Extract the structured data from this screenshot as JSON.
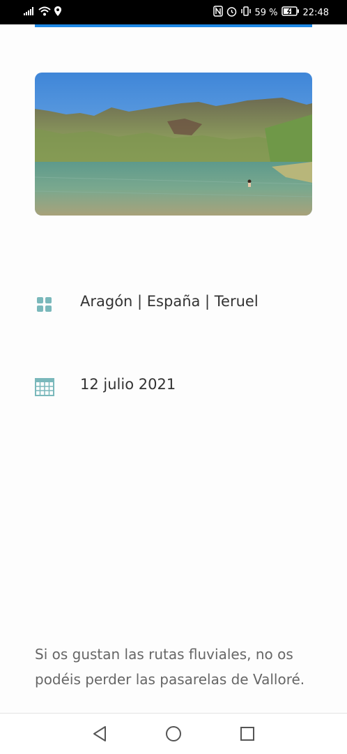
{
  "status_bar": {
    "battery_percent": "59 %",
    "time": "22:48",
    "icons": [
      "signal-icon",
      "wifi-icon",
      "location-icon",
      "nfc-icon",
      "alarm-icon",
      "vibrate-icon",
      "battery-icon"
    ]
  },
  "colors": {
    "accent": "#1e88e5",
    "icon_teal": "#7ab8bb",
    "text": "#333333",
    "excerpt_text": "#666666"
  },
  "article": {
    "hero_image_alt": "mountain-lake-photo",
    "categories_icon": "grid-icon",
    "categories": "Aragón | España | Teruel",
    "date_icon": "calendar-icon",
    "date": "12 julio 2021",
    "excerpt": "Si os gustan las rutas fluviales, no os podéis perder las pasarelas de Valloré."
  },
  "nav_bar": {
    "buttons": [
      "back-icon",
      "home-icon",
      "recents-icon"
    ]
  }
}
